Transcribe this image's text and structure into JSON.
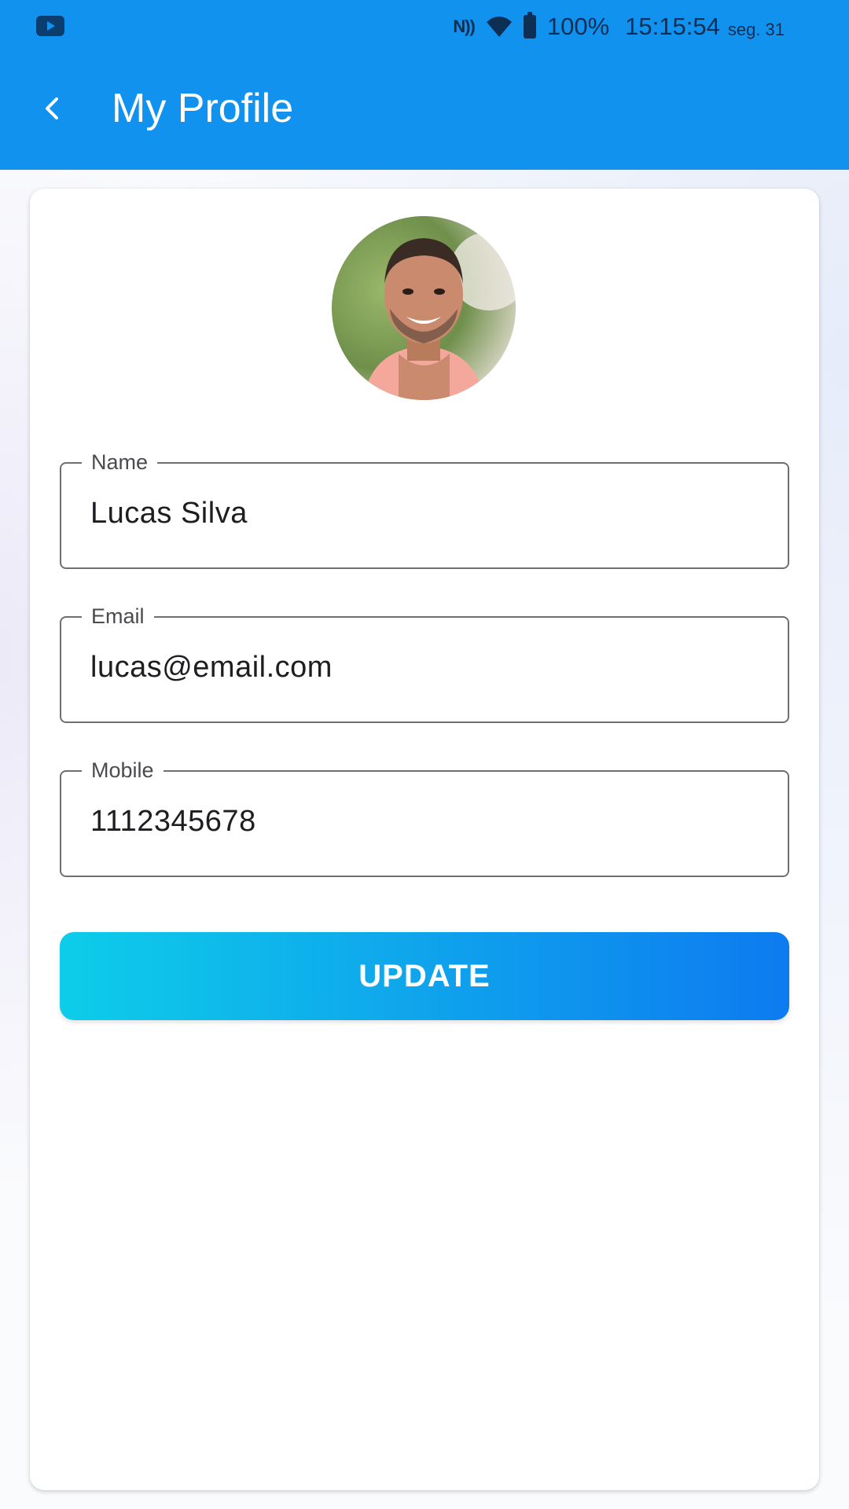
{
  "status_bar": {
    "battery": "100%",
    "time": "15:15:54",
    "date": "seg. 31",
    "icons": [
      "youtube-icon",
      "nfc-icon",
      "wifi-icon",
      "battery-icon"
    ]
  },
  "app_bar": {
    "title": "My Profile",
    "back_icon": "chevron-left-icon",
    "color": "#1192ee"
  },
  "profile": {
    "avatar": "profile-photo",
    "fields": [
      {
        "label": "Name",
        "value": "Lucas Silva"
      },
      {
        "label": "Email",
        "value": "lucas@email.com"
      },
      {
        "label": "Mobile",
        "value": "1112345678"
      }
    ],
    "update_label": "UPDATE",
    "button_gradient": [
      "#0dcde9",
      "#0d7bf0"
    ]
  }
}
